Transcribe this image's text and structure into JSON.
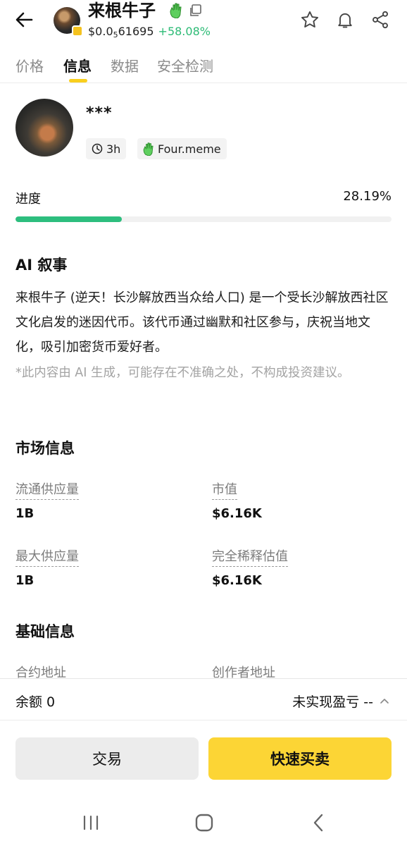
{
  "header": {
    "title": "来根牛子",
    "price_prefix": "$0.0",
    "price_sub": "5",
    "price_rest": "61695",
    "change": "+58.08%"
  },
  "tabs": [
    {
      "label": "价格"
    },
    {
      "label": "信息"
    },
    {
      "label": "数据"
    },
    {
      "label": "安全检测"
    }
  ],
  "token": {
    "name": "***",
    "age": "3h",
    "platform": "Four.meme"
  },
  "progress": {
    "label": "进度",
    "value_text": "28.19%",
    "fraction": 0.2819
  },
  "ai": {
    "title": "AI 叙事",
    "text": "来根牛子 (逆天！长沙解放西当众给人口) 是一个受长沙解放西社区文化启发的迷因代币。该代币通过幽默和社区参与，庆祝当地文化，吸引加密货币爱好者。",
    "disclaimer": "*此内容由 AI 生成，可能存在不准确之处，不构成投资建议。"
  },
  "market": {
    "title": "市场信息",
    "items": [
      {
        "label": "流通供应量",
        "value": "1B"
      },
      {
        "label": "市值",
        "value": "$6.16K"
      },
      {
        "label": "最大供应量",
        "value": "1B"
      },
      {
        "label": "完全稀释估值",
        "value": "$6.16K"
      }
    ]
  },
  "basic": {
    "title": "基础信息",
    "contract_label": "合约地址",
    "creator_label": "创作者地址"
  },
  "bottom": {
    "balance": "余额 0",
    "pnl": "未实现盈亏 --",
    "trade": "交易",
    "quick": "快速买卖"
  },
  "colors": {
    "accent": "#fcd535",
    "positive": "#2dbb76"
  }
}
